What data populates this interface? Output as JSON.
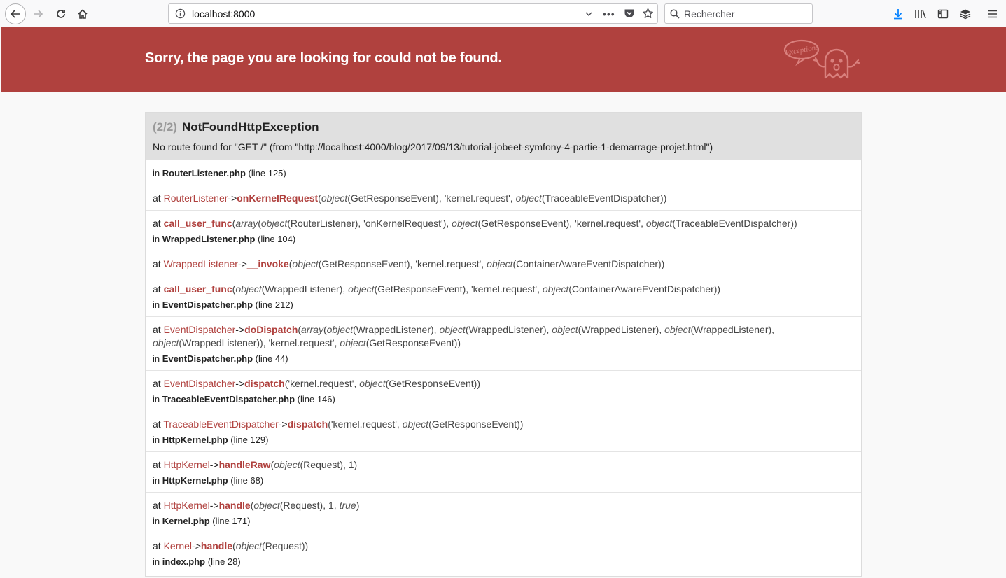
{
  "browser": {
    "url": "localhost:8000",
    "search_placeholder": "Rechercher"
  },
  "banner": {
    "title": "Sorry, the page you are looking for could not be found.",
    "logo_text": "Exception!"
  },
  "exception": {
    "count": "(2/2)",
    "class": "NotFoundHttpException",
    "message": "No route found for \"GET /\" (from \"http://localhost:4000/blog/2017/09/13/tutorial-jobeet-symfony-4-partie-1-demarrage-projet.html\")",
    "first_location": {
      "prefix": "in ",
      "file": "RouterListener.php",
      "line": " (line 125)"
    },
    "trace": [
      {
        "at": "at ",
        "class": "RouterListener",
        "sep": "->",
        "func": "onKernelRequest",
        "open": "(",
        "args": [
          {
            "t": "ar",
            "v": "object"
          },
          {
            "t": "plain",
            "v": "(GetResponseEvent), 'kernel.request', "
          },
          {
            "t": "ar",
            "v": "object"
          },
          {
            "t": "plain",
            "v": "(TraceableEventDispatcher))"
          }
        ]
      },
      {
        "at": "at  ",
        "class": "",
        "sep": "",
        "func": "call_user_func",
        "open": "(",
        "args": [
          {
            "t": "ar",
            "v": "array"
          },
          {
            "t": "plain",
            "v": "("
          },
          {
            "t": "ar",
            "v": "object"
          },
          {
            "t": "plain",
            "v": "(RouterListener), 'onKernelRequest'), "
          },
          {
            "t": "ar",
            "v": "object"
          },
          {
            "t": "plain",
            "v": "(GetResponseEvent), 'kernel.request', "
          },
          {
            "t": "ar",
            "v": "object"
          },
          {
            "t": "plain",
            "v": "(TraceableEventDispatcher))"
          }
        ],
        "loc": {
          "prefix": "in ",
          "file": "WrappedListener.php",
          "line": " (line 104)"
        }
      },
      {
        "at": "at ",
        "class": "WrappedListener",
        "sep": "->",
        "func": "__invoke",
        "open": "(",
        "args": [
          {
            "t": "ar",
            "v": "object"
          },
          {
            "t": "plain",
            "v": "(GetResponseEvent), 'kernel.request', "
          },
          {
            "t": "ar",
            "v": "object"
          },
          {
            "t": "plain",
            "v": "(ContainerAwareEventDispatcher))"
          }
        ]
      },
      {
        "at": "at  ",
        "class": "",
        "sep": "",
        "func": "call_user_func",
        "open": "(",
        "args": [
          {
            "t": "ar",
            "v": "object"
          },
          {
            "t": "plain",
            "v": "(WrappedListener), "
          },
          {
            "t": "ar",
            "v": "object"
          },
          {
            "t": "plain",
            "v": "(GetResponseEvent), 'kernel.request', "
          },
          {
            "t": "ar",
            "v": "object"
          },
          {
            "t": "plain",
            "v": "(ContainerAwareEventDispatcher))"
          }
        ],
        "loc": {
          "prefix": "in ",
          "file": "EventDispatcher.php",
          "line": " (line 212)"
        }
      },
      {
        "at": "at ",
        "class": "EventDispatcher",
        "sep": "->",
        "func": "doDispatch",
        "open": "(",
        "args": [
          {
            "t": "ar",
            "v": "array"
          },
          {
            "t": "plain",
            "v": "("
          },
          {
            "t": "ar",
            "v": "object"
          },
          {
            "t": "plain",
            "v": "(WrappedListener), "
          },
          {
            "t": "ar",
            "v": "object"
          },
          {
            "t": "plain",
            "v": "(WrappedListener), "
          },
          {
            "t": "ar",
            "v": "object"
          },
          {
            "t": "plain",
            "v": "(WrappedListener), "
          },
          {
            "t": "ar",
            "v": "object"
          },
          {
            "t": "plain",
            "v": "(WrappedListener), "
          },
          {
            "t": "ar",
            "v": "object"
          },
          {
            "t": "plain",
            "v": "(WrappedListener)), 'kernel.request', "
          },
          {
            "t": "ar",
            "v": "object"
          },
          {
            "t": "plain",
            "v": "(GetResponseEvent))"
          }
        ],
        "loc": {
          "prefix": "in ",
          "file": "EventDispatcher.php",
          "line": " (line 44)"
        }
      },
      {
        "at": "at ",
        "class": "EventDispatcher",
        "sep": "->",
        "func": "dispatch",
        "open": "(",
        "args": [
          {
            "t": "plain",
            "v": "'kernel.request', "
          },
          {
            "t": "ar",
            "v": "object"
          },
          {
            "t": "plain",
            "v": "(GetResponseEvent))"
          }
        ],
        "loc": {
          "prefix": "in ",
          "file": "TraceableEventDispatcher.php",
          "line": " (line 146)"
        }
      },
      {
        "at": "at ",
        "class": "TraceableEventDispatcher",
        "sep": "->",
        "func": "dispatch",
        "open": "(",
        "args": [
          {
            "t": "plain",
            "v": "'kernel.request', "
          },
          {
            "t": "ar",
            "v": "object"
          },
          {
            "t": "plain",
            "v": "(GetResponseEvent))"
          }
        ],
        "loc": {
          "prefix": "in ",
          "file": "HttpKernel.php",
          "line": " (line 129)"
        }
      },
      {
        "at": "at ",
        "class": "HttpKernel",
        "sep": "->",
        "func": "handleRaw",
        "open": "(",
        "args": [
          {
            "t": "ar",
            "v": "object"
          },
          {
            "t": "plain",
            "v": "(Request), 1)"
          }
        ],
        "loc": {
          "prefix": "in ",
          "file": "HttpKernel.php",
          "line": " (line 68)"
        }
      },
      {
        "at": "at ",
        "class": "HttpKernel",
        "sep": "->",
        "func": "handle",
        "open": "(",
        "args": [
          {
            "t": "ar",
            "v": "object"
          },
          {
            "t": "plain",
            "v": "(Request), 1, "
          },
          {
            "t": "ar",
            "v": "true"
          },
          {
            "t": "plain",
            "v": ")"
          }
        ],
        "loc": {
          "prefix": "in ",
          "file": "Kernel.php",
          "line": " (line 171)"
        }
      },
      {
        "at": "at ",
        "class": "Kernel",
        "sep": "->",
        "func": "handle",
        "open": "(",
        "args": [
          {
            "t": "ar",
            "v": "object"
          },
          {
            "t": "plain",
            "v": "(Request))"
          }
        ],
        "loc": {
          "prefix": "in ",
          "file": "index.php",
          "line": " (line 28)"
        }
      }
    ]
  },
  "colors": {
    "banner": "#b0413e",
    "accent": "#b0413e"
  }
}
